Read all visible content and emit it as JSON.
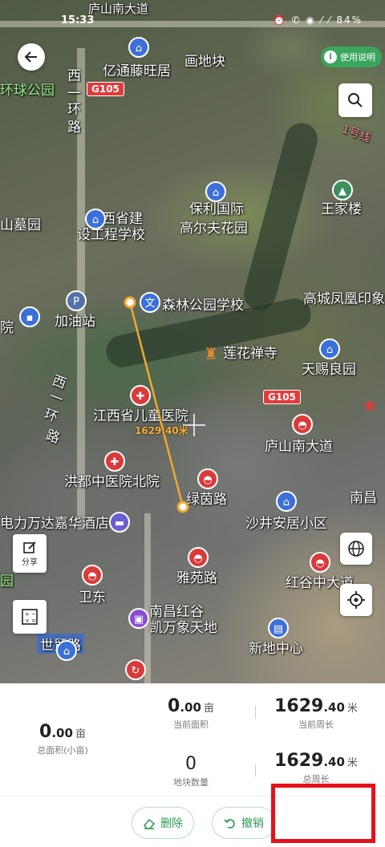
{
  "status_bar": {
    "time": "15:33",
    "battery": "84%",
    "icons": "⏰ ✆ ◉ ⁄ ⁄ "
  },
  "map": {
    "labels": [
      {
        "id": "l1",
        "text": "亿通藤旺居",
        "cls": ""
      },
      {
        "id": "l2",
        "text": "画地块",
        "cls": ""
      },
      {
        "id": "l3",
        "text": "环球公园",
        "cls": "green"
      },
      {
        "id": "l4",
        "text": "西",
        "cls": ""
      },
      {
        "id": "l5",
        "text": "一",
        "cls": ""
      },
      {
        "id": "l6",
        "text": "环",
        "cls": ""
      },
      {
        "id": "l7",
        "text": "路",
        "cls": ""
      },
      {
        "id": "l8",
        "text": "保利国际",
        "cls": ""
      },
      {
        "id": "l9",
        "text": "高尔夫花园",
        "cls": ""
      },
      {
        "id": "l10",
        "text": "王家楼",
        "cls": ""
      },
      {
        "id": "l11",
        "text": "江西省建",
        "cls": ""
      },
      {
        "id": "l12",
        "text": "设工程学校",
        "cls": ""
      },
      {
        "id": "l13",
        "text": "山墓园",
        "cls": ""
      },
      {
        "id": "l14",
        "text": "森林公园学校",
        "cls": ""
      },
      {
        "id": "l15",
        "text": "高城凤凰印象",
        "cls": ""
      },
      {
        "id": "l16",
        "text": "加油站",
        "cls": ""
      },
      {
        "id": "l17",
        "text": "莲花禅寺",
        "cls": ""
      },
      {
        "id": "l18",
        "text": "天赐良园",
        "cls": ""
      },
      {
        "id": "l19",
        "text": "江西省儿童医院",
        "cls": ""
      },
      {
        "id": "l20",
        "text": "庐山南大道",
        "cls": ""
      },
      {
        "id": "l21",
        "text": "洪都中医院北院",
        "cls": ""
      },
      {
        "id": "l22",
        "text": "绿茵路",
        "cls": ""
      },
      {
        "id": "l23",
        "text": "沙井安居小区",
        "cls": ""
      },
      {
        "id": "l24",
        "text": "南昌",
        "cls": ""
      },
      {
        "id": "l25",
        "text": "电力万达嘉华酒店",
        "cls": ""
      },
      {
        "id": "l26",
        "text": "雅苑路",
        "cls": ""
      },
      {
        "id": "l27",
        "text": "红谷中大道",
        "cls": ""
      },
      {
        "id": "l28",
        "text": "卫东",
        "cls": ""
      },
      {
        "id": "l29",
        "text": "南昌红谷",
        "cls": ""
      },
      {
        "id": "l30",
        "text": "凯万象天地",
        "cls": ""
      },
      {
        "id": "l31",
        "text": "世贸路",
        "cls": ""
      },
      {
        "id": "l32",
        "text": "新地中心",
        "cls": ""
      },
      {
        "id": "l33",
        "text": "1号线",
        "cls": "pink"
      },
      {
        "id": "l34",
        "text": "庐山南大道",
        "cls": ""
      },
      {
        "id": "l35",
        "text": "西",
        "cls": ""
      },
      {
        "id": "l36",
        "text": "一",
        "cls": ""
      },
      {
        "id": "l37",
        "text": "环",
        "cls": ""
      },
      {
        "id": "l38",
        "text": "路",
        "cls": ""
      },
      {
        "id": "l39",
        "text": "园",
        "cls": "green"
      },
      {
        "id": "l40",
        "text": "院",
        "cls": ""
      }
    ],
    "road_signs": [
      "G105",
      "G105"
    ],
    "measurement": "1629.40米"
  },
  "controls": {
    "help_label": "使用说明",
    "share_label": "分享"
  },
  "stats": {
    "current_area": {
      "int": "0",
      "dec": ".00",
      "unit": "亩",
      "label": "当前面积"
    },
    "current_perimeter": {
      "int": "1629",
      "dec": ".40",
      "unit": "米",
      "label": "当前周长"
    },
    "total_area": {
      "int": "0",
      "dec": ".00",
      "unit": "亩",
      "label": "总面积(小亩)"
    },
    "plot_count": {
      "val": "0",
      "label": "地块数量"
    },
    "total_perimeter": {
      "int": "1629",
      "dec": ".40",
      "unit": "米",
      "label": "总周长"
    }
  },
  "actions": {
    "delete_label": "删除",
    "undo_label": "撤销"
  },
  "colors": {
    "accent": "#2e9a55",
    "highlight_box": "#e5111b",
    "measure_line": "#f0a830"
  }
}
